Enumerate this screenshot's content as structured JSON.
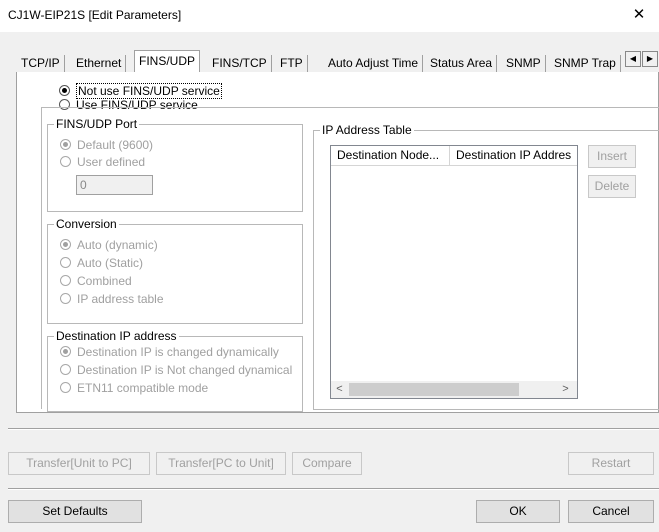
{
  "window": {
    "title": "CJ1W-EIP21S [Edit Parameters]",
    "close": "✕"
  },
  "tabs": [
    {
      "label": "TCP/IP"
    },
    {
      "label": "Ethernet"
    },
    {
      "label": "FINS/UDP"
    },
    {
      "label": "FINS/TCP"
    },
    {
      "label": "FTP"
    },
    {
      "label": "Auto Adjust Time"
    },
    {
      "label": "Status Area"
    },
    {
      "label": "SNMP"
    },
    {
      "label": "SNMP Trap"
    }
  ],
  "tab_scroll": {
    "left": "◀",
    "right": "▶"
  },
  "service": {
    "not_use": "Not use FINS/UDP service",
    "use": "Use FINS/UDP service"
  },
  "port": {
    "label": "FINS/UDP Port",
    "default": "Default (9600)",
    "user_defined": "User defined",
    "value": "0"
  },
  "conversion": {
    "label": "Conversion",
    "options": [
      "Auto (dynamic)",
      "Auto (Static)",
      "Combined",
      "IP address table"
    ]
  },
  "dest_ip": {
    "label": "Destination IP address",
    "options": [
      "Destination IP is changed dynamically",
      "Destination IP is Not changed dynamical",
      "ETN11 compatible mode"
    ]
  },
  "ip_table": {
    "label": "IP Address Table",
    "col1": "Destination Node...",
    "col2": "Destination IP Addres",
    "insert": "Insert",
    "delete": "Delete",
    "scroll_left": "<",
    "scroll_right": ">"
  },
  "buttons": {
    "transfer_unit_pc": "Transfer[Unit to PC]",
    "transfer_pc_unit": "Transfer[PC to Unit]",
    "compare": "Compare",
    "restart": "Restart",
    "set_defaults": "Set Defaults",
    "ok": "OK",
    "cancel": "Cancel"
  }
}
